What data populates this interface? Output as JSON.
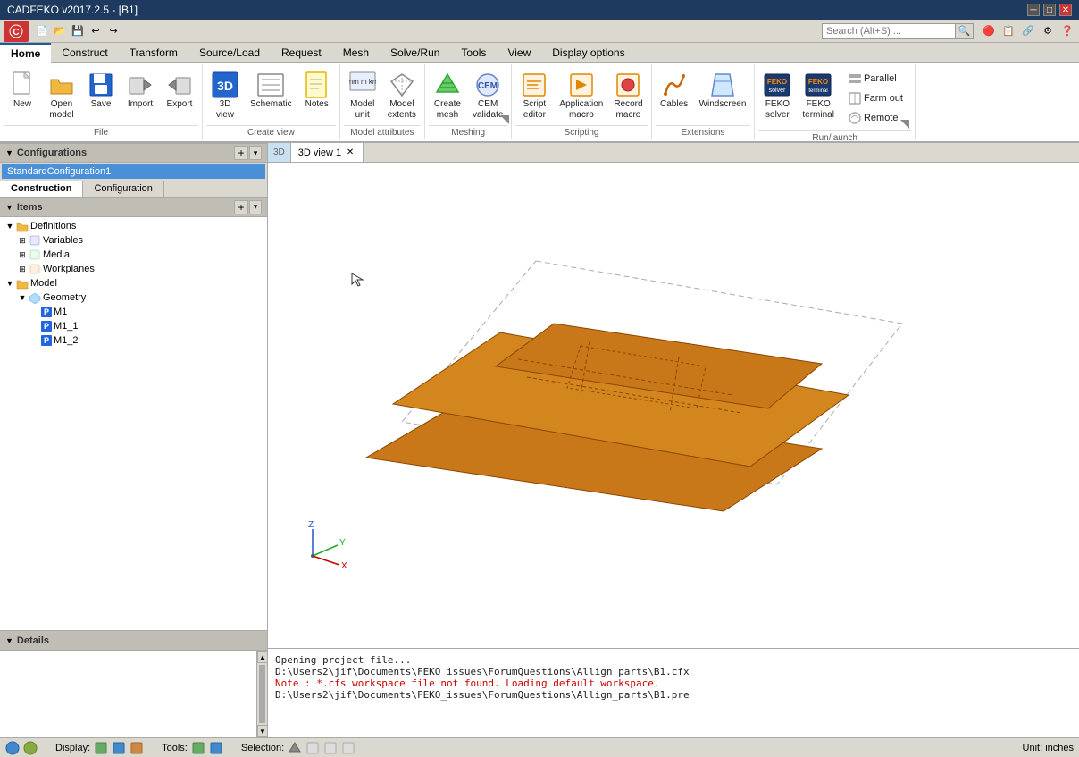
{
  "titlebar": {
    "title": "CADFEKO v2017.2.5 - [B1]",
    "controls": [
      "minimize",
      "maximize",
      "close"
    ]
  },
  "quickaccess": {
    "buttons": [
      "new-icon",
      "open-icon",
      "save-icon",
      "undo-icon",
      "redo-icon"
    ],
    "search_placeholder": "Search (Alt+S) ..."
  },
  "menubar": {
    "tabs": [
      "Home",
      "Construct",
      "Transform",
      "Source/Load",
      "Request",
      "Mesh",
      "Solve/Run",
      "Tools",
      "View",
      "Display options"
    ]
  },
  "ribbon": {
    "groups": [
      {
        "label": "File",
        "items": [
          {
            "id": "new",
            "label": "New",
            "icon": "new-icon"
          },
          {
            "id": "open-model",
            "label": "Open\nmodel",
            "icon": "folder-icon"
          },
          {
            "id": "save",
            "label": "Save",
            "icon": "save-icon"
          },
          {
            "id": "import",
            "label": "Import",
            "icon": "import-icon"
          },
          {
            "id": "export",
            "label": "Export",
            "icon": "export-icon"
          }
        ]
      },
      {
        "label": "Create view",
        "items": [
          {
            "id": "3d-view",
            "label": "3D\nview",
            "icon": "3d-icon"
          },
          {
            "id": "schematic",
            "label": "Schematic",
            "icon": "schematic-icon"
          },
          {
            "id": "notes",
            "label": "Notes",
            "icon": "notes-icon"
          }
        ]
      },
      {
        "label": "Model attributes",
        "items": [
          {
            "id": "model-unit",
            "label": "Model\nunit",
            "icon": "model-unit-icon"
          },
          {
            "id": "model-extents",
            "label": "Model\nextents",
            "icon": "model-extents-icon"
          }
        ]
      },
      {
        "label": "Meshing",
        "items": [
          {
            "id": "create-mesh",
            "label": "Create\nmesh",
            "icon": "create-mesh-icon"
          },
          {
            "id": "cem-validate",
            "label": "CEM\nvalidate",
            "icon": "cem-icon"
          }
        ]
      },
      {
        "label": "Scripting",
        "items": [
          {
            "id": "script-editor",
            "label": "Script\neditor",
            "icon": "script-icon"
          },
          {
            "id": "application-macro",
            "label": "Application\nmacro",
            "icon": "appmacro-icon"
          },
          {
            "id": "record-macro",
            "label": "Record\nmacro",
            "icon": "record-icon"
          }
        ]
      },
      {
        "label": "Extensions",
        "items": [
          {
            "id": "cables",
            "label": "Cables",
            "icon": "cables-icon"
          },
          {
            "id": "windscreen",
            "label": "Windscreen",
            "icon": "windscreen-icon"
          }
        ]
      },
      {
        "label": "Run/launch",
        "items": [
          {
            "id": "feko-solver",
            "label": "FEKO\nsolver",
            "icon": "feko-solver-icon"
          },
          {
            "id": "feko-terminal",
            "label": "FEKO\nterminal",
            "icon": "feko-terminal-icon"
          }
        ],
        "collapse_items": [
          {
            "id": "parallel",
            "label": "Parallel",
            "icon": "parallel-icon"
          },
          {
            "id": "farm-out",
            "label": "Farm out",
            "icon": "farmout-icon"
          },
          {
            "id": "remote",
            "label": "Remote",
            "icon": "remote-icon"
          }
        ]
      }
    ]
  },
  "configurations": {
    "title": "Configurations",
    "items": [
      "StandardConfiguration1"
    ]
  },
  "panel_tabs": {
    "tabs": [
      "Construction",
      "Configuration"
    ]
  },
  "items": {
    "title": "Items",
    "tree": [
      {
        "label": "Definitions",
        "expanded": true,
        "children": [
          {
            "label": "Variables",
            "expanded": false,
            "children": []
          },
          {
            "label": "Media",
            "expanded": false,
            "children": []
          },
          {
            "label": "Workplanes",
            "expanded": false,
            "children": []
          }
        ]
      },
      {
        "label": "Model",
        "expanded": true,
        "children": [
          {
            "label": "Geometry",
            "expanded": true,
            "children": [
              {
                "label": "M1",
                "has_p_icon": true,
                "children": []
              },
              {
                "label": "M1_1",
                "has_p_icon": true,
                "children": []
              },
              {
                "label": "M1_2",
                "has_p_icon": true,
                "children": []
              }
            ]
          }
        ]
      }
    ]
  },
  "details": {
    "title": "Details"
  },
  "view3d": {
    "tab_label": "3D view 1",
    "tab_id": "3d"
  },
  "log": {
    "lines": [
      {
        "text": "Opening project file...",
        "class": "log-normal"
      },
      {
        "text": "D:\\Users2\\jif\\Documents\\FEKO_issues\\ForumQuestions\\Allign_parts\\B1.cfx",
        "class": "log-normal"
      },
      {
        "text": "Note : *.cfs workspace file not found. Loading default workspace.",
        "class": "log-note"
      },
      {
        "text": "D:\\Users2\\jif\\Documents\\FEKO_issues\\ForumQuestions\\Allign_parts\\B1.pre",
        "class": "log-normal"
      }
    ]
  },
  "statusbar": {
    "display_label": "Display:",
    "tools_label": "Tools:",
    "selection_label": "Selection:",
    "unit_label": "Unit: inches"
  }
}
